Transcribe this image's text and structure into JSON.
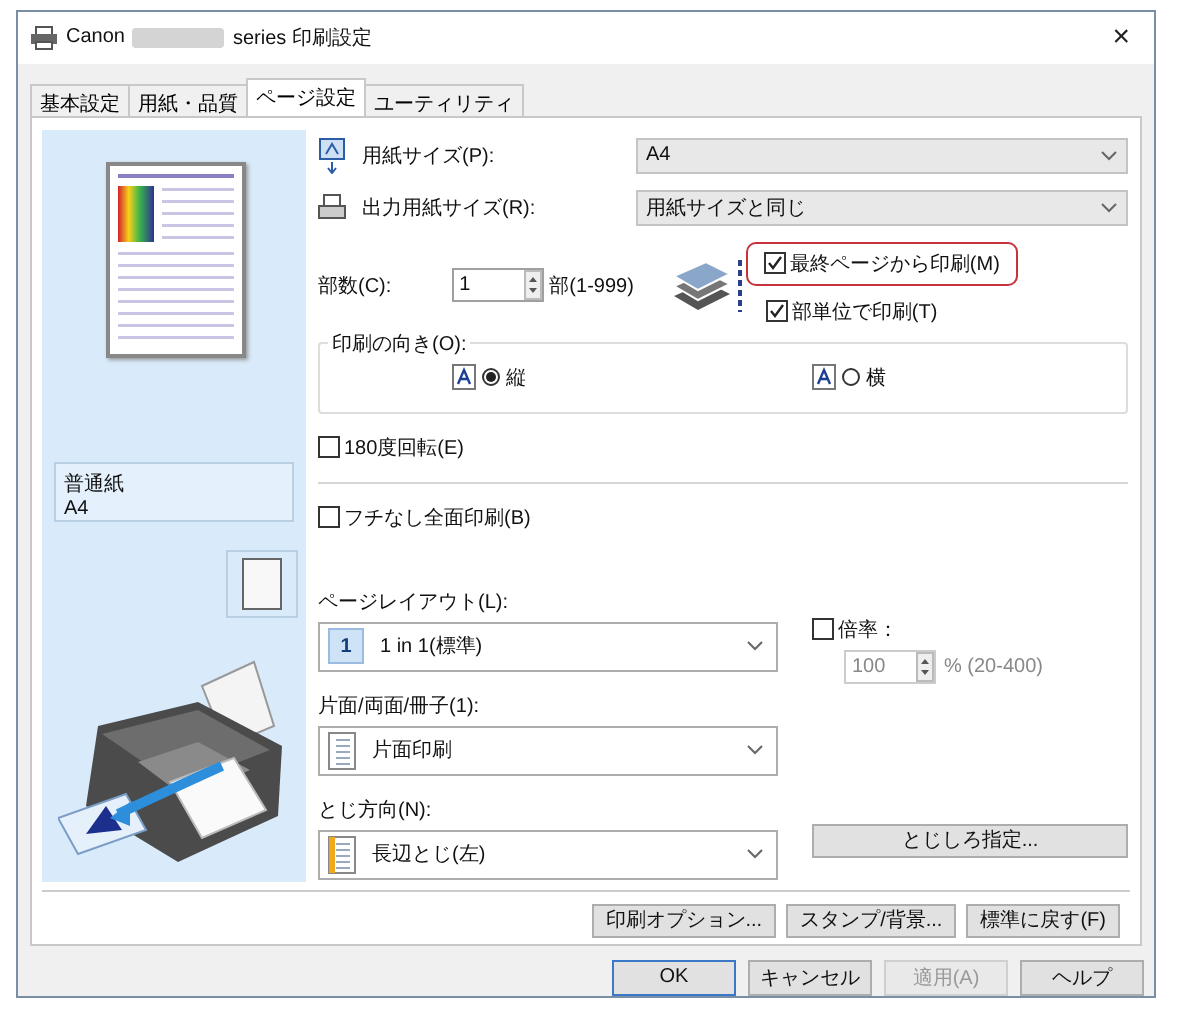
{
  "window": {
    "title_prefix": "Canon",
    "title_suffix": "series 印刷設定",
    "close": "×"
  },
  "tabs": [
    {
      "label": "基本設定",
      "selected": false
    },
    {
      "label": "用紙・品質",
      "selected": false
    },
    {
      "label": "ページ設定",
      "selected": true
    },
    {
      "label": "ユーティリティ",
      "selected": false
    }
  ],
  "preview": {
    "media": "普通紙",
    "size": "A4"
  },
  "paper_size": {
    "label": "用紙サイズ(P):",
    "value": "A4"
  },
  "output_paper_size": {
    "label": "出力用紙サイズ(R):",
    "value": "用紙サイズと同じ"
  },
  "copies": {
    "label": "部数(C):",
    "value": "1",
    "range": "部(1-999)"
  },
  "print_from_last_page": {
    "label": "最終ページから印刷(M)",
    "checked": true,
    "highlighted": true
  },
  "collate": {
    "label": "部単位で印刷(T)",
    "checked": true
  },
  "orientation": {
    "label": "印刷の向き(O):",
    "options": [
      {
        "label": "縦",
        "selected": true
      },
      {
        "label": "横",
        "selected": false
      }
    ]
  },
  "rotate_180": {
    "label": "180度回転(E)",
    "checked": false
  },
  "borderless": {
    "label": "フチなし全面印刷(B)",
    "checked": false
  },
  "page_layout": {
    "label": "ページレイアウト(L):",
    "icon_text": "1",
    "value": "1 in 1(標準)"
  },
  "scaling": {
    "label": "倍率：",
    "checked": false,
    "value": "100",
    "range": "% (20-400)",
    "disabled": true
  },
  "duplex": {
    "label": "片面/両面/冊子(1):",
    "value": "片面印刷"
  },
  "binding": {
    "label": "とじ方向(N):",
    "value": "長辺とじ(左)"
  },
  "margin_button": "とじしろ指定...",
  "option_buttons": [
    "印刷オプション...",
    "スタンプ/背景...",
    "標準に戻す(F)"
  ],
  "dialog_buttons": [
    {
      "label": "OK",
      "kind": "default",
      "disabled": false
    },
    {
      "label": "キャンセル",
      "kind": "normal",
      "disabled": false
    },
    {
      "label": "適用(A)",
      "kind": "normal",
      "disabled": true
    },
    {
      "label": "ヘルプ",
      "kind": "normal",
      "disabled": false
    }
  ]
}
